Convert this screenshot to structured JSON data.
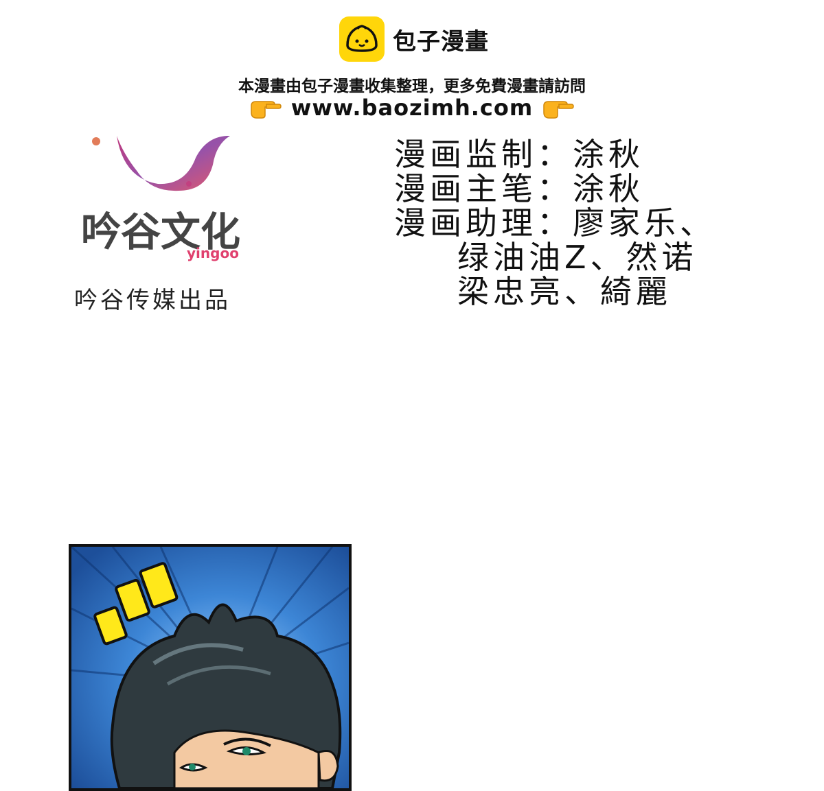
{
  "site": {
    "name": "包子漫畫",
    "notice": "本漫畫由包子漫畫收集整理，更多免費漫畫請訪問",
    "url": "www.baozimh.com",
    "logo_color": "#FFD60A"
  },
  "publisher": {
    "logo_text": "吟谷文化",
    "logo_subtext": "yingoo",
    "credit": "吟谷传媒出品"
  },
  "credits": [
    {
      "text": "漫画监制：涂秋"
    },
    {
      "text": "漫画主笔：涂秋"
    },
    {
      "text": "漫画助理：廖家乐、"
    },
    {
      "text": "绿油油Z、然诺"
    },
    {
      "text": "梁忠亮、綺麗"
    }
  ],
  "panel": {
    "background": "#2b6fbe",
    "accent": "#FFE81A"
  }
}
